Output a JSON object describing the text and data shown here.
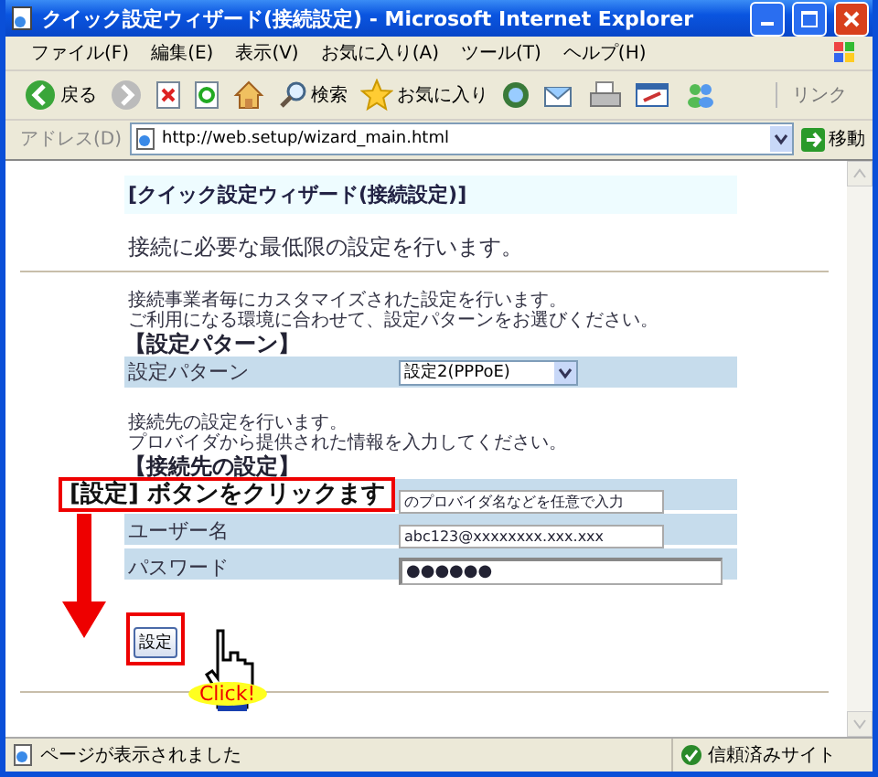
{
  "window": {
    "title": "クイック設定ウィザード(接続設定) - Microsoft Internet Explorer"
  },
  "menu": [
    "ファイル(F)",
    "編集(E)",
    "表示(V)",
    "お気に入り(A)",
    "ツール(T)",
    "ヘルプ(H)"
  ],
  "toolbar": [
    {
      "kind": "back",
      "label": "戻る"
    },
    {
      "kind": "forward"
    },
    {
      "kind": "stop"
    },
    {
      "kind": "refresh"
    },
    {
      "kind": "home"
    },
    {
      "kind": "search",
      "label": "検索"
    },
    {
      "kind": "favorites",
      "label": "お気に入り"
    },
    {
      "kind": "media"
    },
    {
      "kind": "mail"
    },
    {
      "kind": "print"
    },
    {
      "kind": "edit"
    },
    {
      "kind": "messenger"
    }
  ],
  "links": "リンク",
  "address": {
    "label": "アドレス(D)",
    "value": "http://web.setup/wizard_main.html",
    "go": "移動"
  },
  "page": {
    "header": "[クイック設定ウィザード(接続設定)]",
    "lead": "接続に必要な最低限の設定を行います。",
    "sections": [
      {
        "notes": [
          "接続事業者毎にカスタマイズされた設定を行います。",
          "ご利用になる環境に合わせて、設定パターンをお選びください。"
        ],
        "heading": "【設定パターン】",
        "rows": [
          {
            "label": "設定パターン",
            "kind": "select",
            "value": "設定2(PPPoE)"
          }
        ]
      },
      {
        "notes": [
          "接続先の設定を行います。",
          "プロバイダから提供された情報を入力してください。"
        ],
        "heading": "【接続先の設定】",
        "rows": [
          {
            "kind": "text",
            "value": "のプロバイダ名などを任意で入力"
          },
          {
            "label": "ユーザー名",
            "kind": "text",
            "value": "abc123@xxxxxxxx.xxx.xxx"
          },
          {
            "label": "パスワード",
            "kind": "password",
            "value": "●●●●●●"
          }
        ]
      }
    ],
    "submit": "設定"
  },
  "callout": {
    "text": "[設定] ボタンをクリックます",
    "badge": "Click!"
  },
  "status": {
    "message": "ページが表示されました",
    "zone": "信頼済みサイト"
  }
}
